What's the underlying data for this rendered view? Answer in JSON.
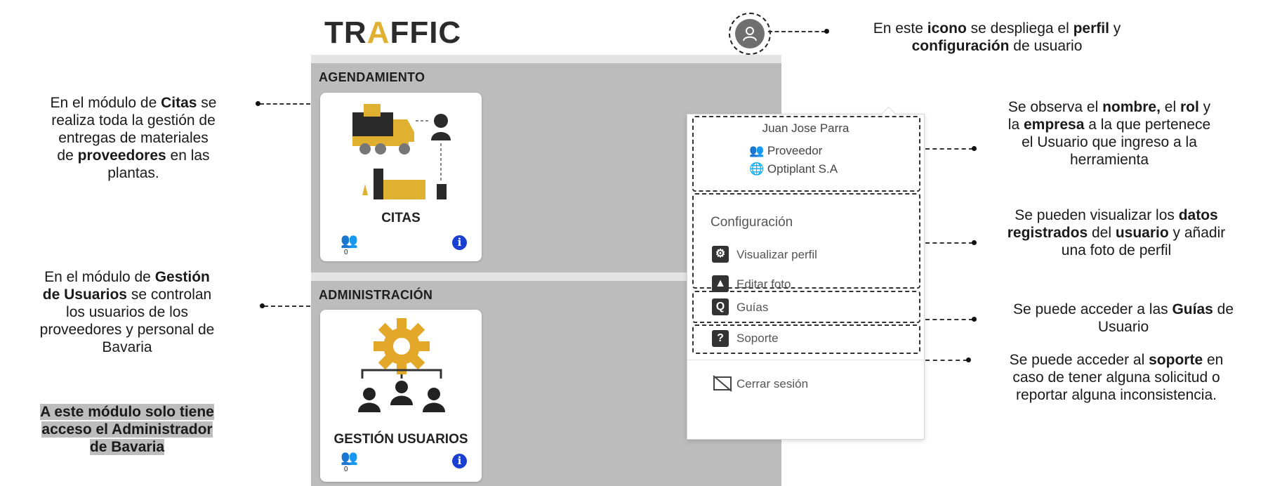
{
  "logo": {
    "part1": "TR",
    "part2": "A",
    "part3": "FFIC"
  },
  "sections": {
    "agendamiento": "AGENDAMIENTO",
    "administracion": "ADMINISTRACIÓN"
  },
  "cards": {
    "citas": {
      "label": "CITAS",
      "count": "0"
    },
    "gestion": {
      "label": "GESTIÓN USUARIOS",
      "count": "0"
    }
  },
  "profile": {
    "name": "Juan Jose Parra",
    "role": "Proveedor",
    "company": "Optiplant S.A"
  },
  "menu": {
    "config_header": "Configuración",
    "view_profile": "Visualizar perfil",
    "edit_photo": "Editar foto",
    "guides": "Guías",
    "support": "Soporte",
    "logout": "Cerrar sesión"
  },
  "annotations": {
    "icon": {
      "t1": "En este ",
      "b1": "icono",
      "t2": " se despliega el ",
      "b2": "perfil",
      "t3": " y",
      "b3": "configuración",
      "t4": "  de usuario"
    },
    "profile": {
      "t1": "Se observa el ",
      "b1": "nombre,",
      "t2": " el ",
      "b2": "rol",
      "t3": " y",
      "b3": "empresa",
      "t4": " a la que pertenece",
      "t5": "el Usuario que ingreso a la",
      "t6": "herramienta",
      "t0": "la "
    },
    "datos": {
      "t1": "Se pueden visualizar los ",
      "b1": "datos",
      "b2": "registrados",
      "t2": " del ",
      "b3": "usuario",
      "t3": " y añadir",
      "t4": "una foto de perfil"
    },
    "guias": {
      "t1": "Se puede acceder a las ",
      "b1": "Guías",
      "t2": " de",
      "t3": "Usuario"
    },
    "soporte": {
      "t1": "Se puede acceder al ",
      "b1": "soporte",
      "t2": " en",
      "t3": "caso de tener alguna solicitud o",
      "t4": "reportar alguna inconsistencia."
    },
    "citas": {
      "t1": "En el módulo de ",
      "b1": "Citas",
      "t2": " se",
      "t3": "realiza toda la gestión de",
      "t4": "entregas de materiales",
      "t5": "de ",
      "b2": "proveedores",
      "t6": " en las",
      "t7": "plantas."
    },
    "gestion": {
      "t1": "En el módulo de ",
      "b1": "Gestión",
      "b2": "de Usuarios",
      "t2": " se controlan",
      "t3": "los usuarios de los",
      "t4": "proveedores y personal de",
      "t5": "Bavaria"
    },
    "admin_note": {
      "l1": "A este  módulo solo tiene",
      "l2": "acceso el Administrador",
      "l3": "de Bavaria"
    }
  }
}
